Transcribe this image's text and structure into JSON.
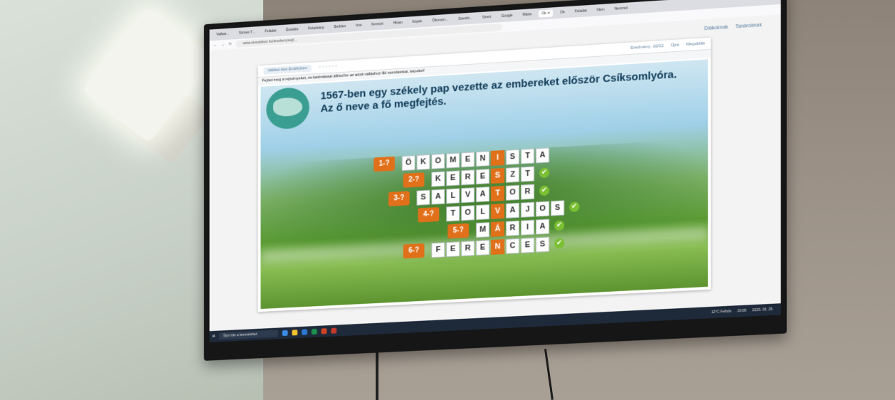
{
  "browser": {
    "tabs": [
      "Vallasi...",
      "Színes T...",
      "Feladat",
      "Éneklés",
      "Feladvány",
      "Bethlen",
      "Ima",
      "Kereszt",
      "Hittan",
      "Képek",
      "Ökumen...",
      "Szentír...",
      "Szent",
      "Google",
      "Mária",
      "Ok",
      "Feladat",
      "Nem",
      "Nemzeti"
    ],
    "active_tab": "Ok ✕",
    "url": "www.okosdoboz.hu/tevekenyseg/...",
    "nav_icons": [
      "back-icon",
      "forward-icon",
      "reload-icon"
    ]
  },
  "site_nav": {
    "students": "Diákoknak",
    "teachers": "Tanároknak"
  },
  "app": {
    "title": "Vallási élet Erdélyben",
    "score_label": "Eredmény: 10/12",
    "retry": "Újra",
    "solution": "Megoldás",
    "instruction": "Fejtsd meg a rejtvényeket, és kattintással állítsd be az adott valláshoz illő mondatokat, képeket!",
    "question_line1": "1567-ben egy székely pap vezette az embereket először Csíksomlyóra.",
    "question_line2": "Az ő neve a fő megfejtés."
  },
  "puzzle": {
    "rows": [
      {
        "label": "1-?",
        "letters": [
          "Ö",
          "K",
          "O",
          "M",
          "E",
          "N",
          "I",
          "S",
          "T",
          "A"
        ],
        "key_index": 6,
        "checked": false
      },
      {
        "label": "2-?",
        "letters": [
          "K",
          "E",
          "R",
          "E",
          "S",
          "Z",
          "T"
        ],
        "key_index": 4,
        "checked": true
      },
      {
        "label": "3-?",
        "letters": [
          "S",
          "A",
          "L",
          "V",
          "A",
          "T",
          "O",
          "R"
        ],
        "key_index": 5,
        "checked": true
      },
      {
        "label": "4-?",
        "letters": [
          "T",
          "O",
          "L",
          "V",
          "A",
          "J",
          "O",
          "S"
        ],
        "key_index": 3,
        "checked": true
      },
      {
        "label": "5-?",
        "letters": [
          "M",
          "Á",
          "R",
          "I",
          "A"
        ],
        "key_index": 1,
        "checked": true
      },
      {
        "label": "6-?",
        "letters": [
          "F",
          "E",
          "R",
          "E",
          "N",
          "C",
          "E",
          "S"
        ],
        "key_index": 4,
        "checked": true
      }
    ],
    "check_symbol": "✔",
    "key_color": "#e1701a",
    "check_color": "#7bbf32"
  },
  "taskbar": {
    "search_placeholder": "Írjon ide a kereséshez",
    "weather": "12°C Felhős",
    "time": "19:06",
    "date": "2025. 05. 25."
  }
}
